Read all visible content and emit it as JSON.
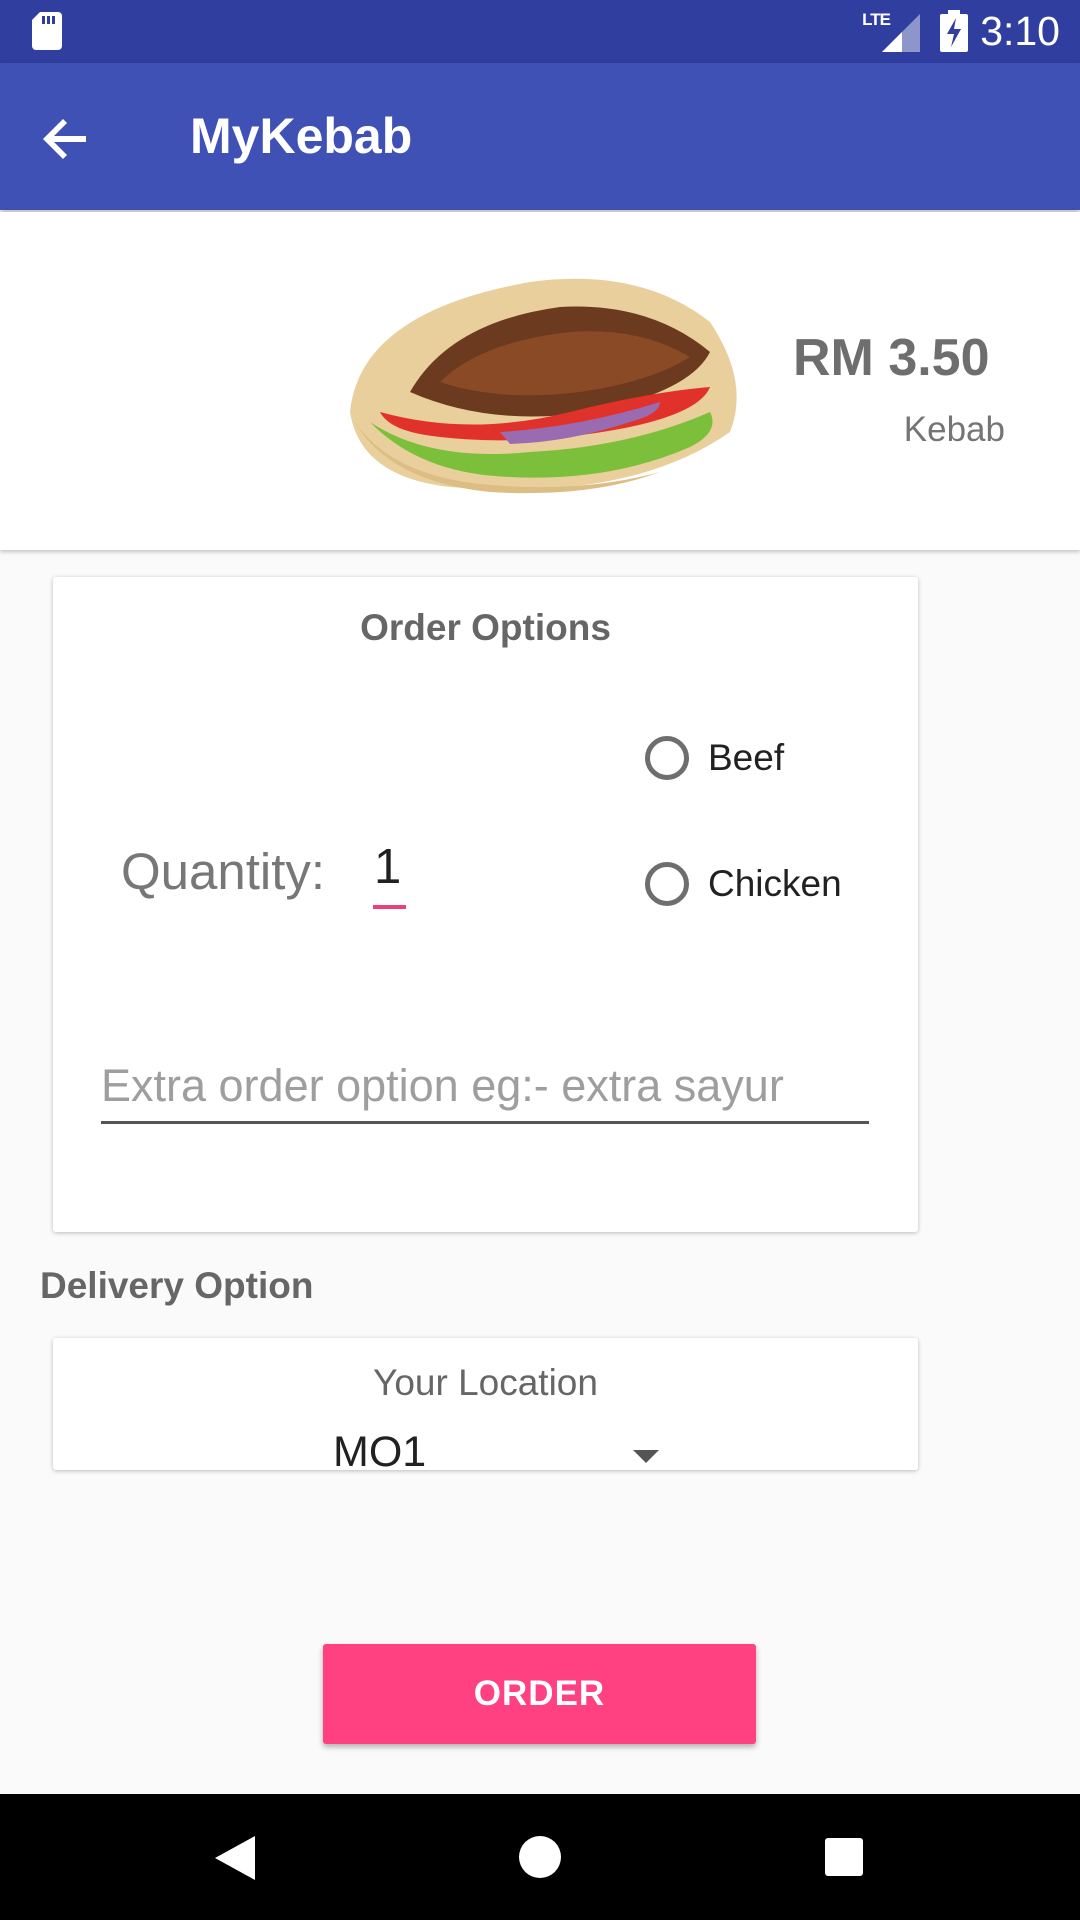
{
  "status_bar": {
    "network_label": "LTE",
    "time": "3:10",
    "icons": [
      "sd-card-icon",
      "signal-icon",
      "battery-charging-icon"
    ]
  },
  "app_bar": {
    "title": "MyKebab",
    "back_icon": "arrow-back-icon"
  },
  "product": {
    "price": "RM 3.50",
    "name": "Kebab"
  },
  "order_options": {
    "title": "Order Options",
    "quantity_label": "Quantity:",
    "quantity_value": "1",
    "meat_options": [
      {
        "label": "Beef",
        "selected": false
      },
      {
        "label": "Chicken",
        "selected": false
      }
    ],
    "extra_placeholder": "Extra order option eg:- extra sayur",
    "extra_value": ""
  },
  "delivery": {
    "title": "Delivery Option",
    "location_label": "Your Location",
    "location_value": "MO1"
  },
  "order_button": {
    "label": "ORDER"
  },
  "colors": {
    "primary": "#3f51b5",
    "primary_dark": "#303f9f",
    "accent": "#ff4081"
  },
  "nav_bar": {
    "icons": [
      "back-triangle-icon",
      "home-circle-icon",
      "recents-square-icon"
    ]
  }
}
